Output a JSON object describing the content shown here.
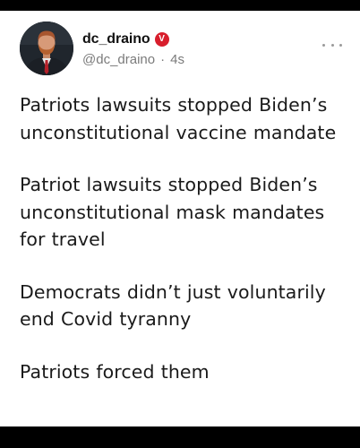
{
  "post": {
    "display_name": "dc_draino",
    "verified_badge": "V",
    "handle": "@dc_draino",
    "separator": "·",
    "timestamp": "4s",
    "more_icon": "more-dots-icon",
    "paragraphs": [
      "Patriots lawsuits stopped Biden’s unconstitutional vaccine mandate",
      "Patriot lawsuits stopped Biden’s unconstitutional mask mandates for travel",
      "Democrats didn’t just voluntarily end Covid tyranny",
      "Patriots forced them"
    ]
  },
  "colors": {
    "verified_badge": "#d81e2c",
    "handle_text": "#7b7b7b",
    "body_text": "#1a1a1a"
  }
}
